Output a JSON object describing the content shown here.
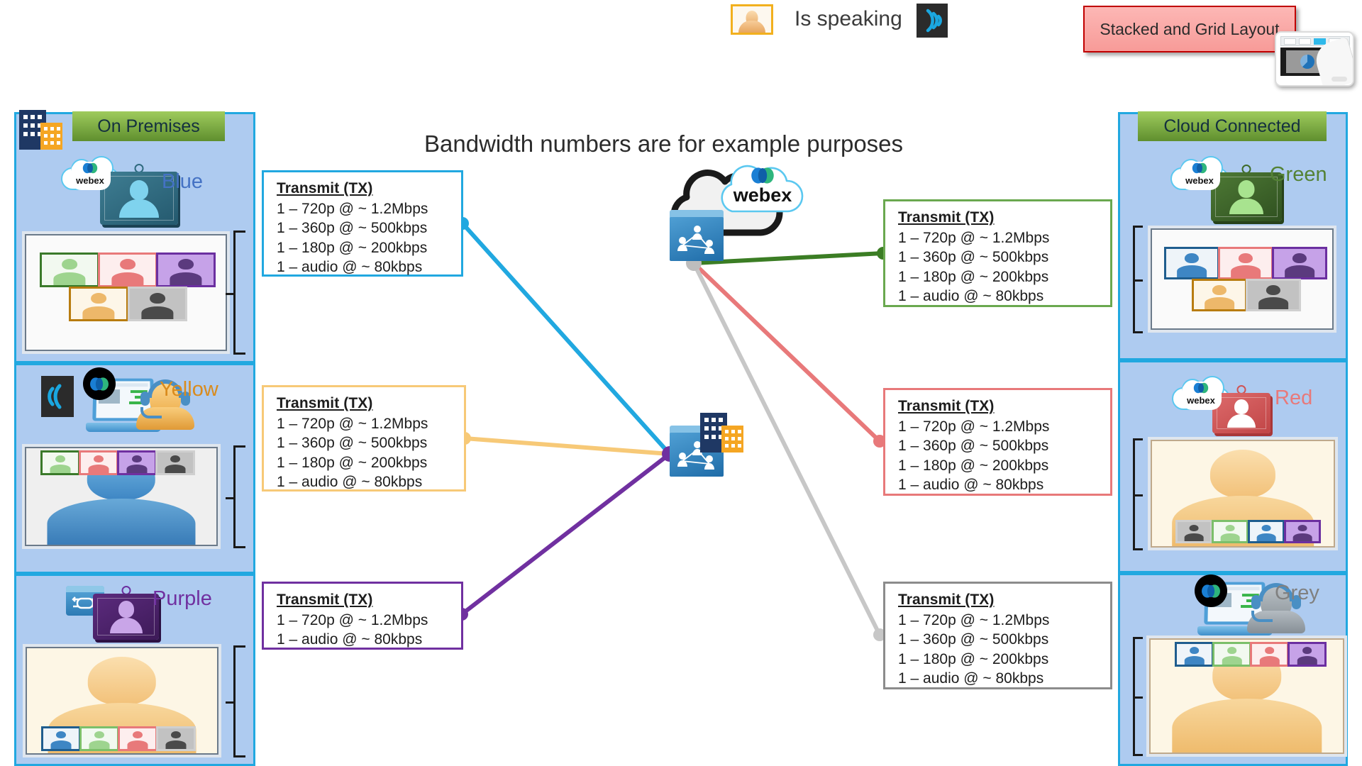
{
  "legend": {
    "speaker_thumb_name": "active-speaker-thumbnail",
    "label": "Is speaking",
    "audio_icon": "speaking-audio-waves-icon"
  },
  "callout": {
    "label": "Stacked and Grid Layout",
    "thumb_icon": "layout-selector-touchscreen-icon",
    "fill_color": "#f79b98",
    "border_color": "#c00000"
  },
  "title": "Bandwidth numbers are for example purposes",
  "headers": {
    "on_premises": "On Premises",
    "cloud_connected": "Cloud Connected"
  },
  "brand": {
    "webex_word": "webex",
    "panel_fill": "#aecbf0",
    "panel_border": "#21a8e0",
    "header_green_top": "#9fcb5d",
    "header_green_bottom": "#5f8f2e"
  },
  "endpoints": {
    "blue": {
      "label": "Blue",
      "color": "#4472c4",
      "device": "webex-room-endpoint",
      "badge": "webex-cloud-badge",
      "layout": "grid"
    },
    "yellow": {
      "label": "Yellow",
      "color": "#d98b1d",
      "device": "webex-app-laptop",
      "badge": "webex-app-badge",
      "layout": "stacked-top"
    },
    "purple": {
      "label": "Purple",
      "color": "#7030a0",
      "device": "webex-room-endpoint",
      "badge": "router-icon",
      "layout": "stacked-bottom"
    },
    "green": {
      "label": "Green",
      "color": "#548235",
      "device": "webex-room-endpoint",
      "badge": "webex-cloud-badge",
      "layout": "grid"
    },
    "red": {
      "label": "Red",
      "color": "#e8797a",
      "device": "webex-room-endpoint",
      "badge": "webex-cloud-badge",
      "layout": "stacked-bottom"
    },
    "grey": {
      "label": "Grey",
      "color": "#808080",
      "device": "webex-app-laptop",
      "badge": "webex-app-badge",
      "layout": "stacked-top"
    }
  },
  "tx_boxes": {
    "heading": "Transmit (TX)",
    "blue": {
      "color": "#21a8e0",
      "lines": [
        "1 – 720p @ ~ 1.2Mbps",
        "1 – 360p @ ~ 500kbps",
        "1 – 180p @ ~ 200kbps",
        "1 – audio @ ~ 80kbps"
      ]
    },
    "yellow": {
      "color": "#f7c977",
      "lines": [
        "1 – 720p @ ~ 1.2Mbps",
        "1 – 360p @ ~ 500kbps",
        "1 – 180p @ ~ 200kbps",
        "1 – audio @ ~ 80kbps"
      ]
    },
    "purple": {
      "color": "#7030a0",
      "lines": [
        "1 – 720p @ ~ 1.2Mbps",
        "1 – audio @ ~ 80kbps"
      ]
    },
    "green": {
      "color": "#6aa84f",
      "lines": [
        "1 – 720p @ ~ 1.2Mbps",
        "1 – 360p @ ~ 500kbps",
        "1 – 180p @ ~ 200kbps",
        "1 – audio @ ~ 80kbps"
      ]
    },
    "red": {
      "color": "#e8797a",
      "lines": [
        "1 – 720p @ ~ 1.2Mbps",
        "1 – 360p @ ~ 500kbps",
        "1 – 180p @ ~ 200kbps",
        "1 – audio @ ~ 80kbps"
      ]
    },
    "grey": {
      "color": "#8c8c8c",
      "lines": [
        "1 – 720p @ ~ 1.2Mbps",
        "1 – 360p @ ~ 500kbps",
        "1 – 180p @ ~ 200kbps",
        "1 – audio @ ~ 80kbps"
      ]
    }
  },
  "hubs": {
    "cloud": {
      "name": "webex-cloud-hub",
      "word": "webex"
    },
    "on_prem": {
      "name": "on-premises-hub"
    }
  },
  "participant_colors": {
    "green": "#7bbf6a",
    "red": "#e8797a",
    "purple": "#8e63b5",
    "orange": "#e8a33d",
    "grey": "#6f6f6f",
    "blue": "#3e86c4"
  }
}
